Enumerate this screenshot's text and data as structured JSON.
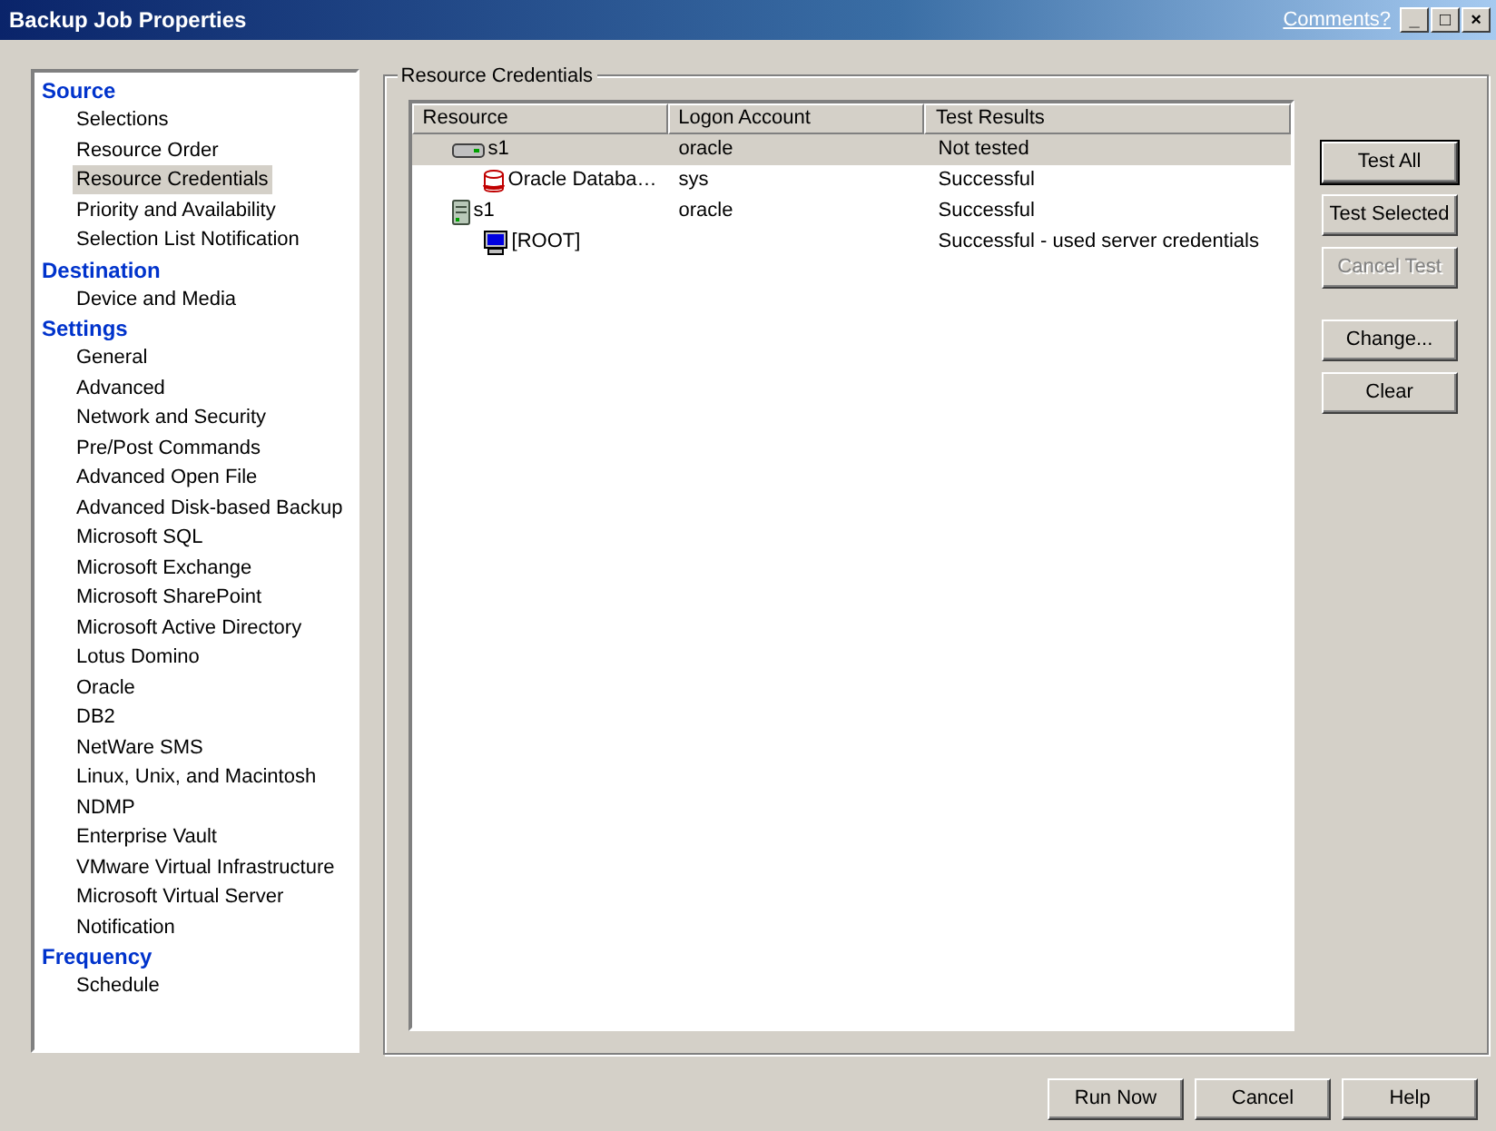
{
  "window": {
    "title": "Backup Job Properties",
    "link": "Comments?",
    "controls": [
      "_",
      "□",
      "×"
    ]
  },
  "sidebar": [
    {
      "title": "Source",
      "items": [
        {
          "label": "Selections",
          "selected": false
        },
        {
          "label": "Resource Order",
          "selected": false
        },
        {
          "label": "Resource Credentials",
          "selected": true
        },
        {
          "label": "Priority and Availability",
          "selected": false
        },
        {
          "label": "Selection List Notification",
          "selected": false
        }
      ]
    },
    {
      "title": "Destination",
      "items": [
        {
          "label": "Device and Media",
          "selected": false
        }
      ]
    },
    {
      "title": "Settings",
      "items": [
        {
          "label": "General",
          "selected": false
        },
        {
          "label": "Advanced",
          "selected": false
        },
        {
          "label": "Network and Security",
          "selected": false
        },
        {
          "label": "Pre/Post Commands",
          "selected": false
        },
        {
          "label": "Advanced Open File",
          "selected": false
        },
        {
          "label": "Advanced Disk-based Backup",
          "selected": false
        },
        {
          "label": "Microsoft SQL",
          "selected": false
        },
        {
          "label": "Microsoft Exchange",
          "selected": false
        },
        {
          "label": "Microsoft SharePoint",
          "selected": false
        },
        {
          "label": "Microsoft Active Directory",
          "selected": false
        },
        {
          "label": "Lotus Domino",
          "selected": false
        },
        {
          "label": "Oracle",
          "selected": false
        },
        {
          "label": "DB2",
          "selected": false
        },
        {
          "label": "NetWare SMS",
          "selected": false
        },
        {
          "label": "Linux, Unix, and Macintosh",
          "selected": false
        },
        {
          "label": "NDMP",
          "selected": false
        },
        {
          "label": "Enterprise Vault",
          "selected": false
        },
        {
          "label": "VMware Virtual Infrastructure",
          "selected": false
        },
        {
          "label": "Microsoft Virtual Server",
          "selected": false
        },
        {
          "label": "Notification",
          "selected": false
        }
      ]
    },
    {
      "title": "Frequency",
      "items": [
        {
          "label": "Schedule",
          "selected": false
        }
      ]
    }
  ],
  "group": {
    "title": "Resource Credentials",
    "table": {
      "columns": [
        "Resource",
        "Logon Account",
        "Test Results"
      ],
      "rows": [
        {
          "kind": "host",
          "resource": "s1",
          "account": "oracle",
          "result": "Not tested",
          "selected": true,
          "children": [
            {
              "kind": "database",
              "resource": "Oracle Databa…",
              "account": "sys",
              "result": "Successful",
              "selected": false
            }
          ]
        },
        {
          "kind": "server",
          "resource": "s1",
          "account": "oracle",
          "result": "Successful",
          "selected": false,
          "children": [
            {
              "kind": "computer",
              "resource": "[ROOT]",
              "result": "Successful - used server credentials",
              "selected": false
            }
          ]
        }
      ]
    },
    "button_groups": [
      [
        {
          "label": "Test All",
          "disabled": false,
          "default": true
        },
        {
          "label": "Test Selected",
          "disabled": false,
          "default": false
        },
        {
          "label": "Cancel Test",
          "disabled": true,
          "default": false
        }
      ],
      [
        {
          "label": "Change...",
          "disabled": false,
          "default": false
        },
        {
          "label": "Clear",
          "disabled": false,
          "default": false
        }
      ]
    ]
  },
  "footer": [
    "Run Now",
    "Cancel",
    "Help"
  ]
}
